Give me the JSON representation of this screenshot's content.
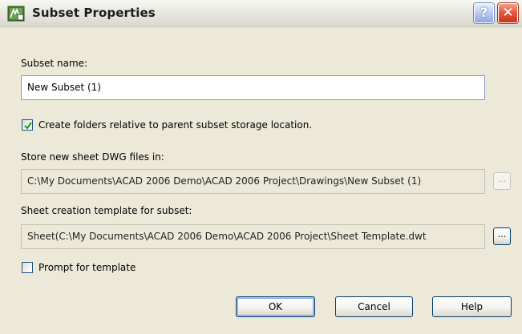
{
  "window": {
    "title": "Subset Properties",
    "help_glyph": "?",
    "close_glyph": "✕",
    "icon": "autocad-sheetset-icon"
  },
  "subset_name": {
    "label": "Subset name:",
    "value": "New Subset (1)"
  },
  "create_folders": {
    "checked": true,
    "label": "Create folders relative to parent subset storage location."
  },
  "store_location": {
    "label": "Store new sheet DWG files in:",
    "value": "C:\\My Documents\\ACAD 2006 Demo\\ACAD 2006 Project\\Drawings\\New Subset (1)",
    "browse_label": "...",
    "browse_enabled": false
  },
  "template": {
    "label": "Sheet creation template for subset:",
    "value": "Sheet(C:\\My Documents\\ACAD 2006 Demo\\ACAD 2006 Project\\Sheet Template.dwt",
    "browse_label": "...",
    "browse_enabled": true
  },
  "prompt_template": {
    "checked": false,
    "label": "Prompt for template"
  },
  "buttons": {
    "ok": "OK",
    "cancel": "Cancel",
    "help": "Help"
  },
  "colors": {
    "dialog_bg": "#ece9d8",
    "field_border": "#7f9db9",
    "button_border": "#003c74",
    "close_red": "#e0563c",
    "help_blue": "#8ea7e1",
    "checkmark_green": "#21a121"
  }
}
